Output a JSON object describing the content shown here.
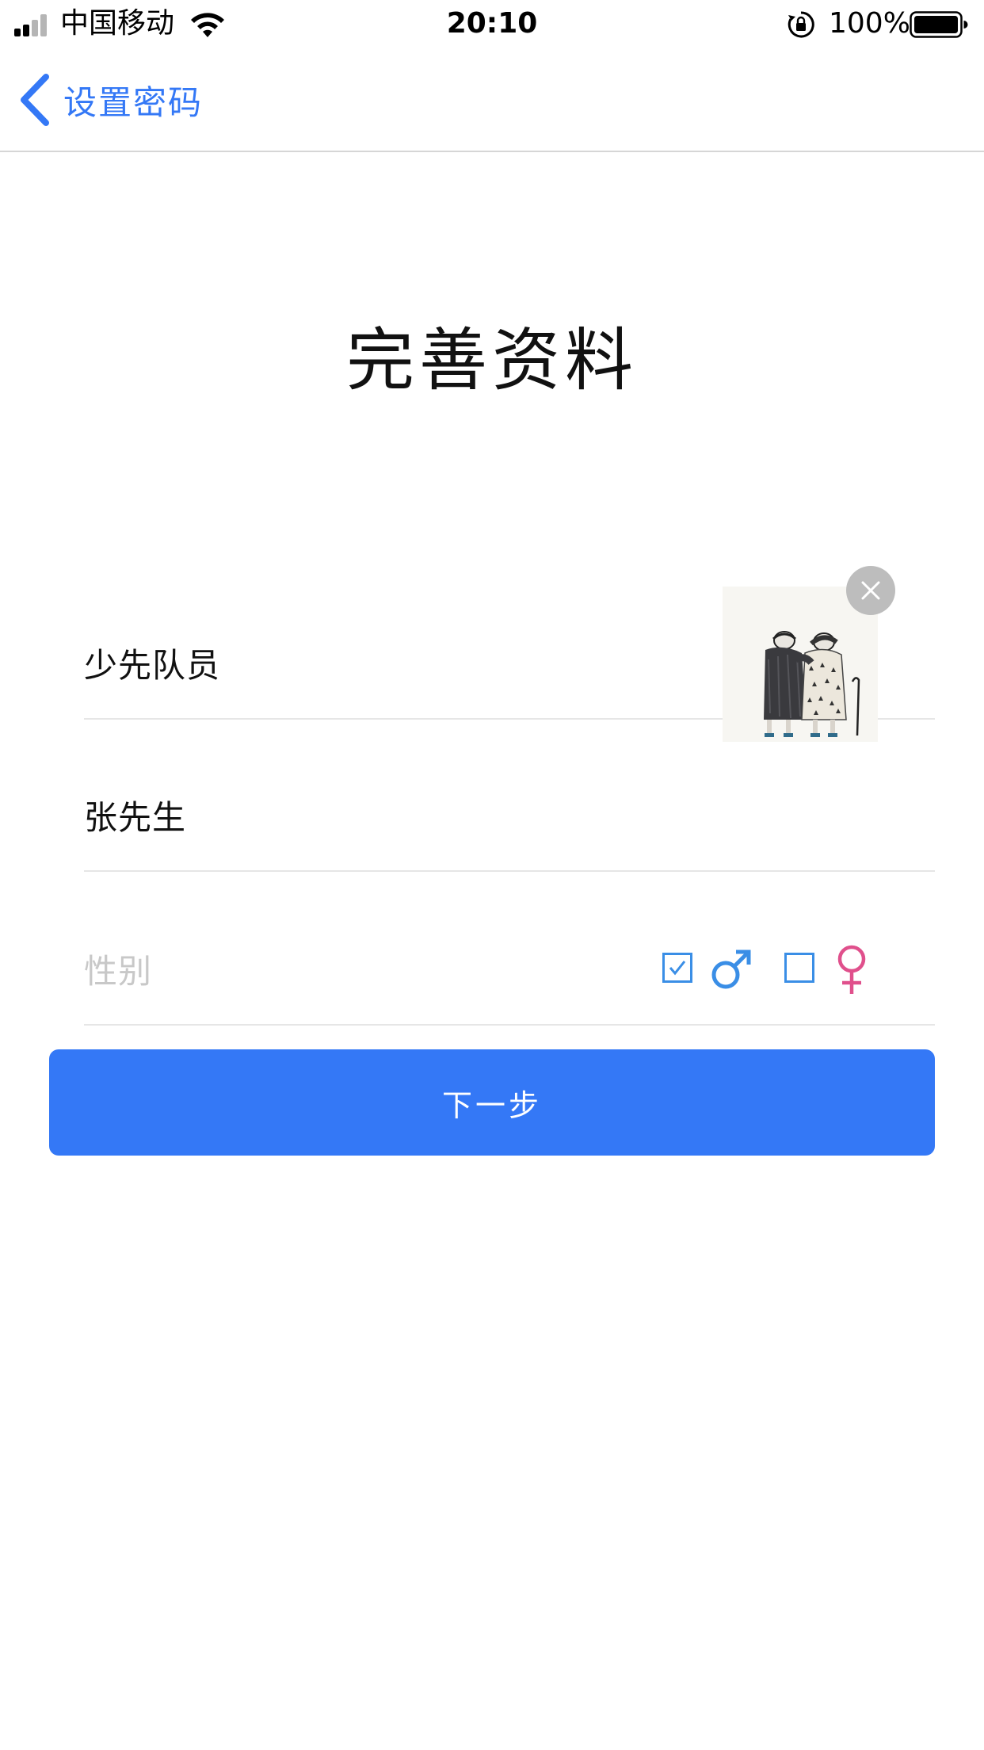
{
  "status_bar": {
    "carrier": "中国移动",
    "time": "20:10",
    "battery_percent": "100%",
    "signal_bars": 2,
    "icons": [
      "signal-icon",
      "wifi-icon",
      "rotation-lock-icon",
      "battery-icon"
    ]
  },
  "nav": {
    "back_label": "设置密码",
    "back_icon": "chevron-left-icon"
  },
  "page": {
    "title": "完善资料"
  },
  "form": {
    "role_value": "少先队员",
    "name_value": "张先生",
    "gender_placeholder": "性别",
    "gender_options": [
      {
        "name": "male",
        "icon": "male-symbol-icon",
        "checked": true,
        "color": "#3a8ee6"
      },
      {
        "name": "female",
        "icon": "female-symbol-icon",
        "checked": false,
        "color": "#e0508c"
      }
    ],
    "avatar_icon": "avatar-image",
    "remove_icon": "close-icon"
  },
  "actions": {
    "next_label": "下一步"
  },
  "colors": {
    "accent": "#3478f6",
    "divider": "#e6e6e6",
    "placeholder": "#c8c8c8",
    "remove_button": "#bdbdbd"
  }
}
